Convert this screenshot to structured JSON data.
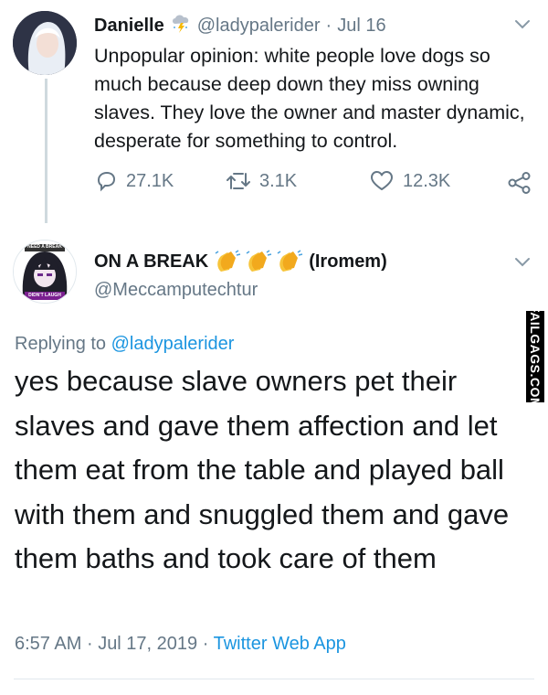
{
  "parent_tweet": {
    "display_name": "Danielle",
    "handle": "@ladypalerider",
    "separator": "·",
    "date": "Jul 16",
    "text": "Unpopular opinion: white people love dogs so much because deep down they miss owning slaves. They love the owner and master dynamic, desperate for something to control.",
    "replies": "27.1K",
    "retweets": "3.1K",
    "likes": "12.3K"
  },
  "reply_tweet": {
    "display_name": "ON A BREAK",
    "name_suffix": "(Iromem)",
    "handle": "@Meccamputechtur",
    "replying_label": "Replying to",
    "replying_handle": "@ladypalerider",
    "text": "yes because slave owners pet their slaves and gave them affection and let them eat from the table and played ball with them and snuggled them and gave them baths and took care of them",
    "time": "6:57 AM",
    "date": "Jul 17, 2019",
    "source": "Twitter Web App",
    "avatar_badge_top": "NEED A BREAK",
    "avatar_badge_bottom": "DIDN'T LAUGH"
  },
  "watermark": "FAILGAGS.COM",
  "colors": {
    "accent": "#1b95e0",
    "muted": "#657786",
    "text": "#14171a"
  }
}
